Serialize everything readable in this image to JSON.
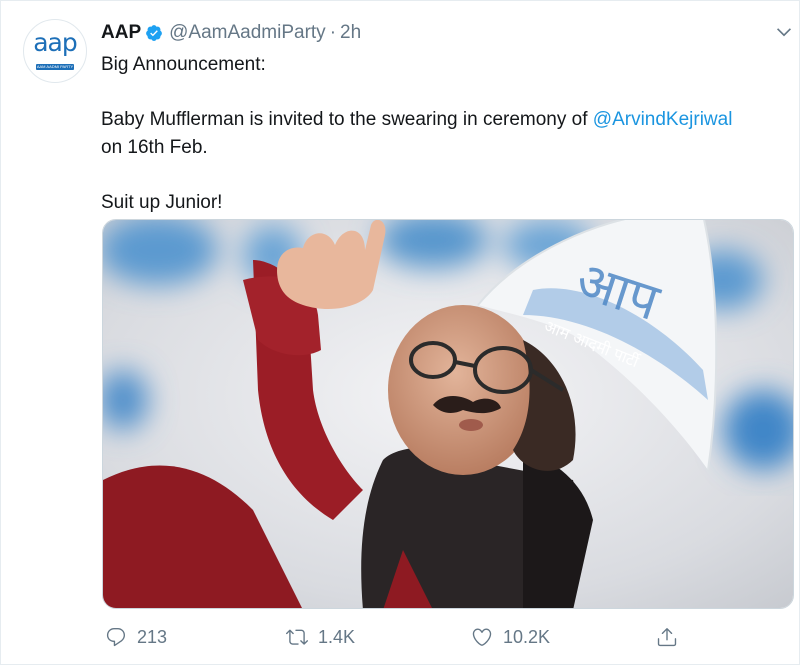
{
  "tweet": {
    "avatar_logo_text": "aap",
    "avatar_logo_sub": "AAM AADMI PARTY",
    "author_name": "AAP",
    "handle": "@AamAadmiParty",
    "separator": "·",
    "time": "2h",
    "text": {
      "line1": "Big Announcement:",
      "line2_before": "Baby Mufflerman is invited to the swearing in ceremony of ",
      "mention": "@ArvindKejriwal",
      "line2_after": " on 16th Feb.",
      "line3": "Suit up Junior!"
    },
    "photo_cap_text_large": "आप",
    "photo_cap_text_small": "आम आदमी पार्टी"
  },
  "actions": {
    "reply_count": "213",
    "retweet_count": "1.4K",
    "like_count": "10.2K"
  },
  "colors": {
    "link": "#1b95e0",
    "secondary_text": "#657786",
    "verified": "#1da1f2",
    "brand": "#1d6fb8"
  },
  "icons": [
    "verified-badge-icon",
    "chevron-down-icon",
    "reply-icon",
    "retweet-icon",
    "like-icon",
    "share-icon"
  ]
}
